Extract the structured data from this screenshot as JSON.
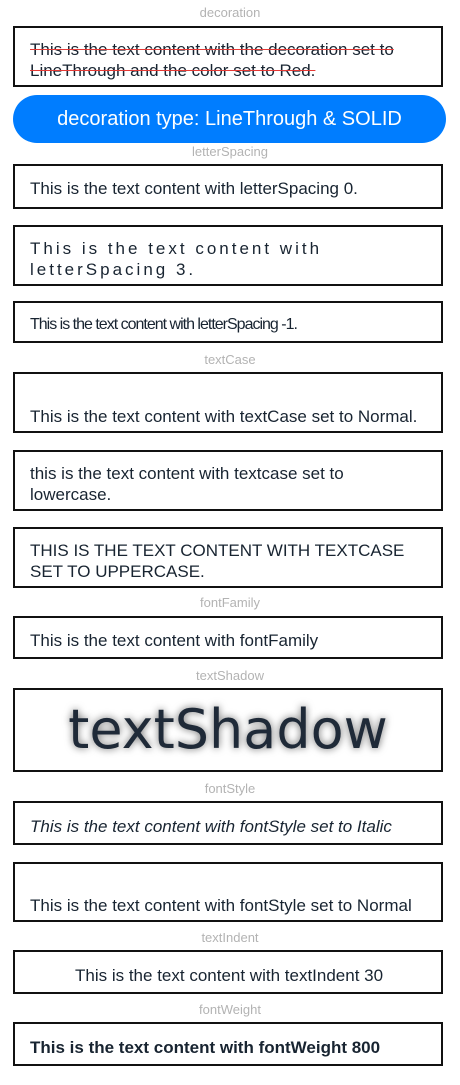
{
  "sections": {
    "decoration": "decoration",
    "letterSpacing": "letterSpacing",
    "textCase": "textCase",
    "fontFamily": "fontFamily",
    "textShadow": "textShadow",
    "fontStyle": "fontStyle",
    "textIndent": "textIndent",
    "fontWeight": "fontWeight"
  },
  "texts": {
    "decoration": "This is the text content with the decoration set to LineThrough and the color set to Red.",
    "decoration_button": "decoration type:  LineThrough & SOLID",
    "ls0": "This is the text content with letterSpacing 0.",
    "ls3": "This is the text content with letterSpacing 3.",
    "lsm1": "This is the text content with letterSpacing -1.",
    "case_normal": "This is the text content with textCase set to Normal.",
    "case_lower": "this is the text content with textcase set to lowercase.",
    "case_upper": "THIS IS THE TEXT CONTENT WITH TEXTCASE SET TO UPPERCASE.",
    "font_family": "This is the text content with fontFamily",
    "shadow": "textShadow",
    "italic": "This is the text content with fontStyle set to Italic",
    "normal": "This is the text content with fontStyle set to Normal",
    "indent": "This is the text content with textIndent 30",
    "weight": "This is the text content with fontWeight 800"
  },
  "colors": {
    "accent": "#007dff",
    "decoration": "#ff0000"
  }
}
